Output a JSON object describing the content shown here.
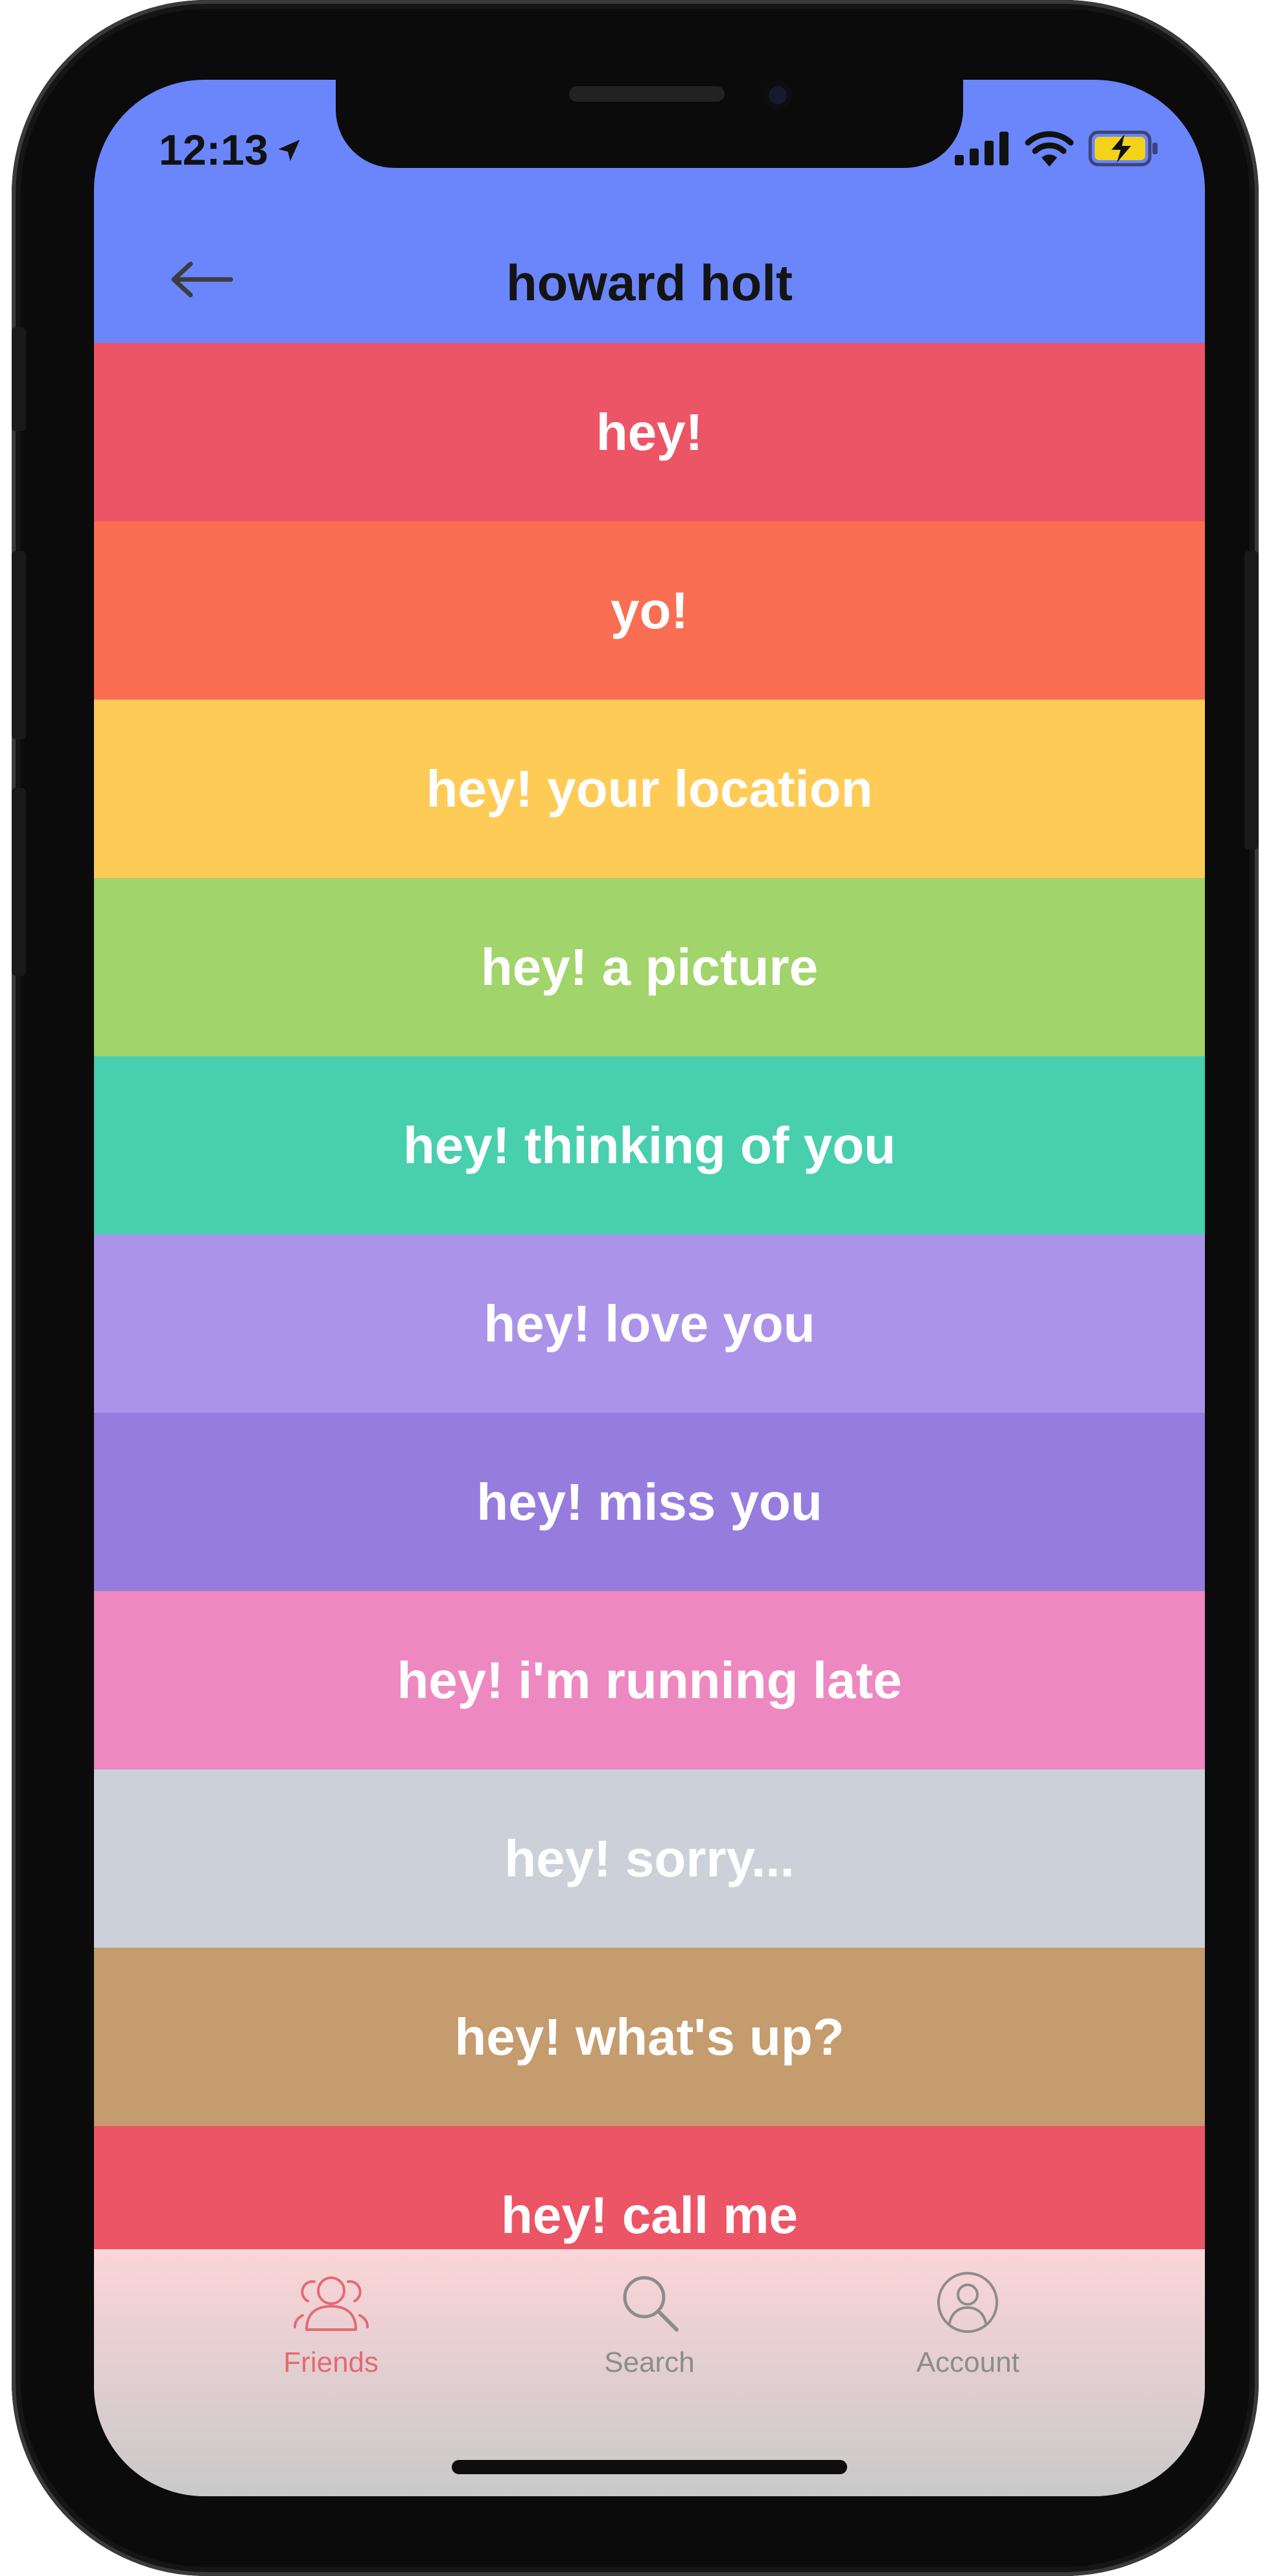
{
  "status_bar": {
    "time": "12:13",
    "location_icon": "location-arrow-icon",
    "signal_icon": "cellular-signal-icon",
    "wifi_icon": "wifi-icon",
    "battery_icon": "battery-charging-icon",
    "battery_color": "#f2d31a"
  },
  "header": {
    "title": "howard holt",
    "back_icon": "back-arrow-icon",
    "background": "#6b86fb"
  },
  "messages": [
    {
      "label": "hey!",
      "color": "#ec5565"
    },
    {
      "label": "yo!",
      "color": "#f96e52"
    },
    {
      "label": "hey! your location",
      "color": "#fecb57"
    },
    {
      "label": "hey! a picture",
      "color": "#a1d46a"
    },
    {
      "label": "hey! thinking of you",
      "color": "#48cfae"
    },
    {
      "label": "hey! love you",
      "color": "#ab93ea"
    },
    {
      "label": "hey! miss you",
      "color": "#967cdd"
    },
    {
      "label": "hey! i'm running late",
      "color": "#ed88c1"
    },
    {
      "label": "hey! sorry...",
      "color": "#ccd1d9"
    },
    {
      "label": "hey! what's up?",
      "color": "#c59c6d"
    },
    {
      "label": "hey! call me",
      "color": "#ec5565"
    }
  ],
  "tabs": [
    {
      "label": "Friends",
      "icon": "friends-icon",
      "active": true
    },
    {
      "label": "Search",
      "icon": "search-icon",
      "active": false
    },
    {
      "label": "Account",
      "icon": "account-icon",
      "active": false
    }
  ],
  "colors": {
    "tab_active": "#e46a73",
    "tab_inactive": "#8c8c8c"
  }
}
